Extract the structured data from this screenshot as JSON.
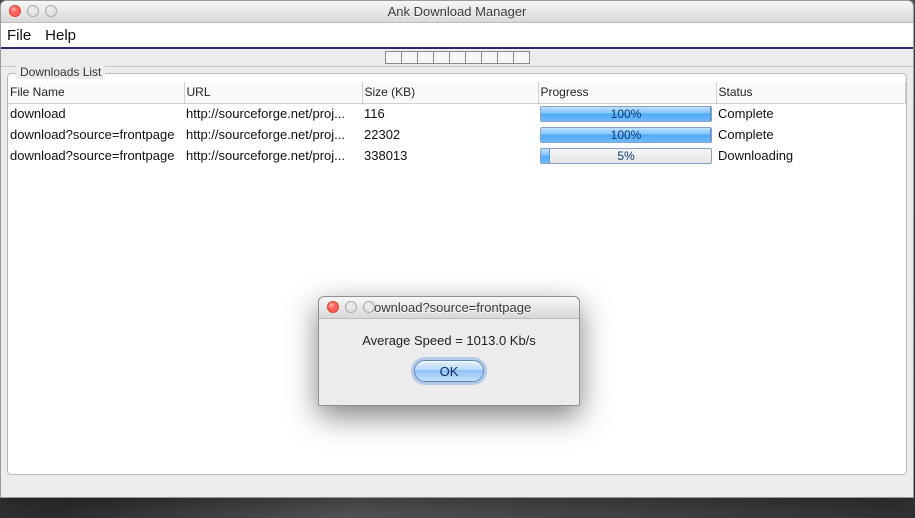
{
  "window": {
    "title": "Ank Download Manager",
    "menus": {
      "file": "File",
      "help": "Help"
    }
  },
  "group": {
    "label": "Downloads List"
  },
  "columns": {
    "file": "File Name",
    "url": "URL",
    "size": "Size (KB)",
    "progress": "Progress",
    "status": "Status"
  },
  "rows": [
    {
      "file": "download",
      "url": "http://sourceforge.net/proj...",
      "size": "116",
      "progress": 100,
      "progress_label": "100%",
      "status": "Complete"
    },
    {
      "file": "download?source=frontpage",
      "url": "http://sourceforge.net/proj...",
      "size": "22302",
      "progress": 100,
      "progress_label": "100%",
      "status": "Complete"
    },
    {
      "file": "download?source=frontpage",
      "url": "http://sourceforge.net/proj...",
      "size": "338013",
      "progress": 5,
      "progress_label": "5%",
      "status": "Downloading"
    }
  ],
  "dialog": {
    "title": "download?source=frontpage",
    "message": "Average Speed = 1013.0 Kb/s",
    "ok": "OK"
  }
}
